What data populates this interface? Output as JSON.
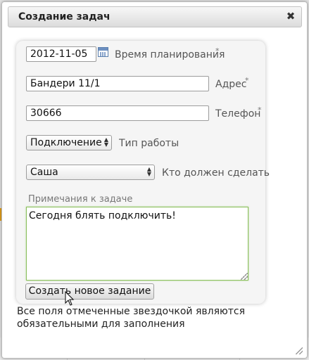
{
  "dialog": {
    "title": "Создание задач",
    "close_icon": "close-icon",
    "required_note_line1": "Все поля отмеченные звездочкой являются",
    "required_note_line2": "обязательными для заполнения"
  },
  "form": {
    "date": {
      "value": "2012-11-05",
      "label": "Время планирования",
      "required": "*"
    },
    "address": {
      "value": "Бандери 11/1",
      "label": "Адрес",
      "required": "*"
    },
    "phone": {
      "value": "30666",
      "label": "Телефон",
      "required": "*"
    },
    "work_type": {
      "selected": "Подключение",
      "label": "Тип работы"
    },
    "assignee": {
      "selected": "Саша",
      "label": "Кто должен сделать"
    },
    "notes": {
      "label": "Примечания к задаче",
      "value": "Сегодня блять подключить!"
    },
    "submit_label": "Создать новое задание"
  },
  "colors": {
    "focus_border": "#8bbf5d",
    "panel_bg": "#f5f5f5"
  }
}
